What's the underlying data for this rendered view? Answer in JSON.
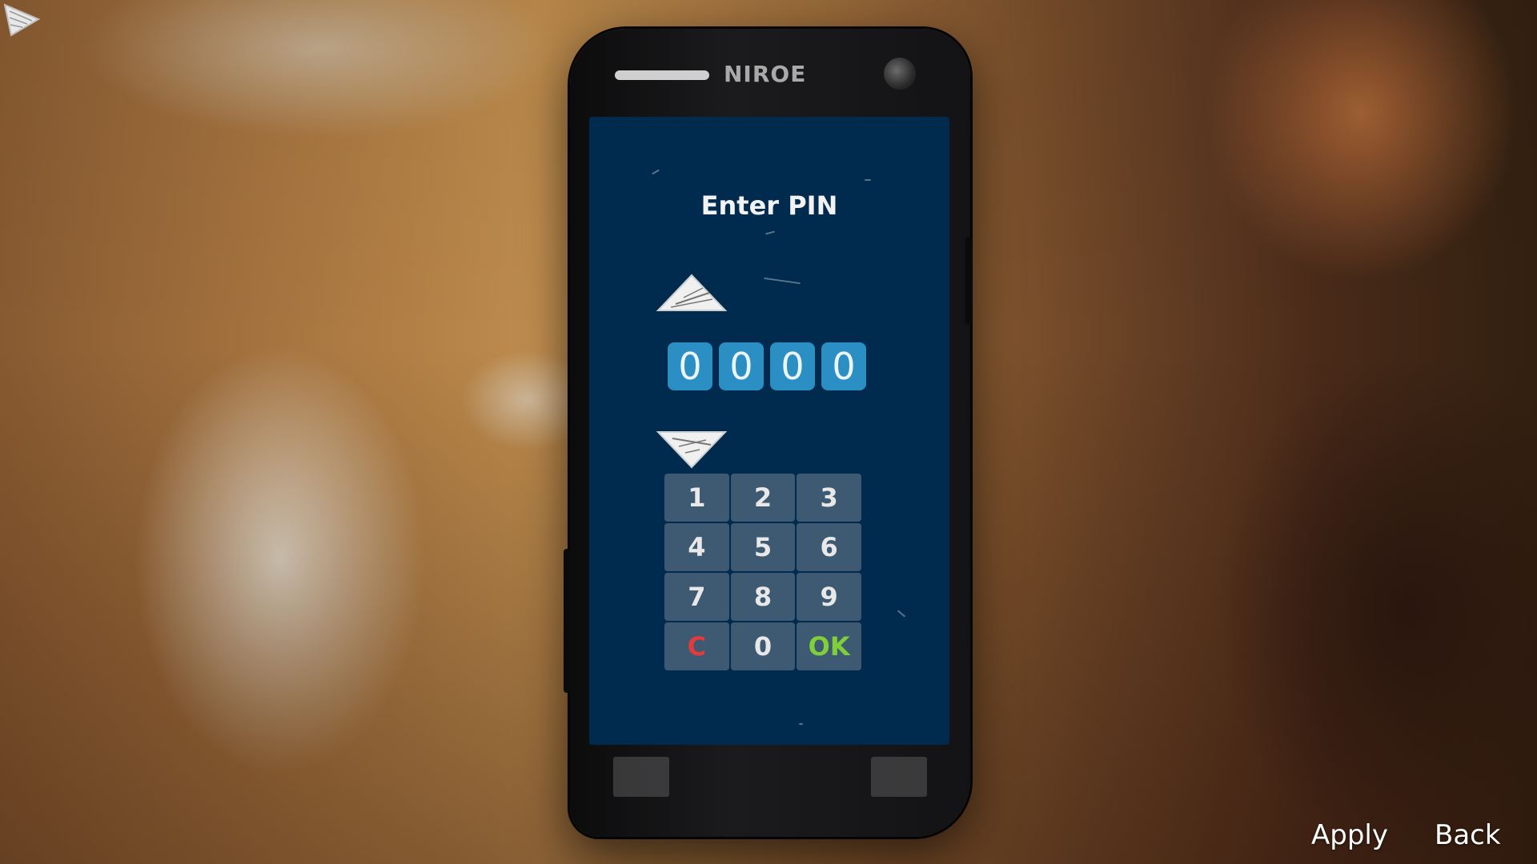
{
  "phone": {
    "brand": "NIROE",
    "screen_title": "Enter PIN",
    "pin_digits": [
      "0",
      "0",
      "0",
      "0"
    ],
    "keypad": [
      "1",
      "2",
      "3",
      "4",
      "5",
      "6",
      "7",
      "8",
      "9",
      "C",
      "0",
      "OK"
    ]
  },
  "footer": {
    "apply_label": "Apply",
    "back_label": "Back"
  },
  "icons": {
    "cursor": "triangle-pointer-icon",
    "increment": "arrow-up-icon",
    "decrement": "arrow-down-icon"
  },
  "colors": {
    "screen_bg": "#002b4e",
    "digit_bg": "#2b8fc4",
    "key_bg": "#3e5a72",
    "clear_key": "#e33b3b",
    "ok_key": "#7fcf3a"
  }
}
